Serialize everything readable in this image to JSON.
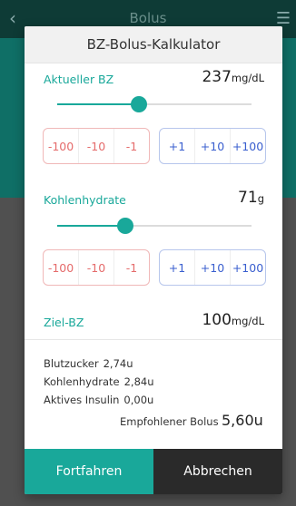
{
  "background": {
    "title": "Bolus",
    "back_icon": "chevron-left-icon",
    "menu_icon": "hamburger-menu-icon"
  },
  "dialog": {
    "title": "BZ-Bolus-Kalkulator",
    "current_bg": {
      "label": "Aktueller BZ",
      "value": "237",
      "unit": "mg/dL",
      "slider_level": 0.42,
      "decrement_buttons": [
        "-100",
        "-10",
        "-1"
      ],
      "increment_buttons": [
        "+1",
        "+10",
        "+100"
      ]
    },
    "carbs": {
      "label": "Kohlenhydrate",
      "value": "71",
      "unit": "g",
      "slider_level": 0.35,
      "decrement_buttons": [
        "-100",
        "-10",
        "-1"
      ],
      "increment_buttons": [
        "+1",
        "+10",
        "+100"
      ]
    },
    "target_bg": {
      "label": "Ziel-BZ",
      "value": "100",
      "unit": "mg/dL"
    },
    "summary": {
      "blood_sugar_label": "Blutzucker",
      "blood_sugar_value": "2,74u",
      "carbs_label": "Kohlenhydrate",
      "carbs_value": "2,84u",
      "active_insulin_label": "Aktives Insulin",
      "active_insulin_value": "0,00u",
      "recommended_label": "Empfohlener Bolus",
      "recommended_value": "5,60u"
    },
    "buttons": {
      "continue": "Fortfahren",
      "cancel": "Abbrechen"
    }
  },
  "colors": {
    "accent": "#19a89a",
    "negative": "#e56b6b",
    "positive": "#3a5fcf",
    "cancel_bg": "#2a2a2a"
  }
}
